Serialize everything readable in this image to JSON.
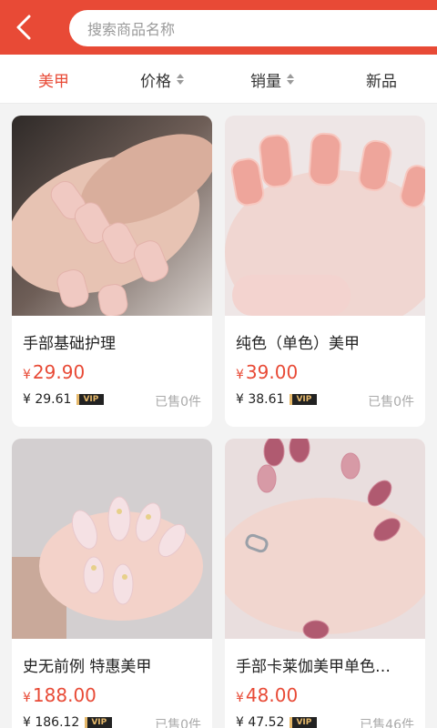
{
  "header": {
    "search_placeholder": "搜索商品名称",
    "back_icon": "chevron-left-icon"
  },
  "tabs": [
    {
      "label": "美甲",
      "active": true
    },
    {
      "label": "价格",
      "sortable": true
    },
    {
      "label": "销量",
      "sortable": true
    },
    {
      "label": "新品"
    }
  ],
  "products": [
    {
      "title": "手部基础护理",
      "currency": "¥",
      "price": "29.90",
      "vip_price": "¥ 29.61",
      "vip_label": "VIP",
      "sold": "已售0件"
    },
    {
      "title": "纯色（单色）美甲",
      "currency": "¥",
      "price": "39.00",
      "vip_price": "¥ 38.61",
      "vip_label": "VIP",
      "sold": "已售0件"
    },
    {
      "title": "史无前例 特惠美甲",
      "currency": "¥",
      "price": "188.00",
      "vip_price": "¥ 186.12",
      "vip_label": "VIP",
      "sold": "已售0件"
    },
    {
      "title": "手部卡莱伽美甲单色…",
      "currency": "¥",
      "price": "48.00",
      "vip_price": "¥ 47.52",
      "vip_label": "VIP",
      "sold": "已售46件"
    }
  ],
  "colors": {
    "accent": "#e84a36",
    "vip_gold": "#e6b96b"
  }
}
